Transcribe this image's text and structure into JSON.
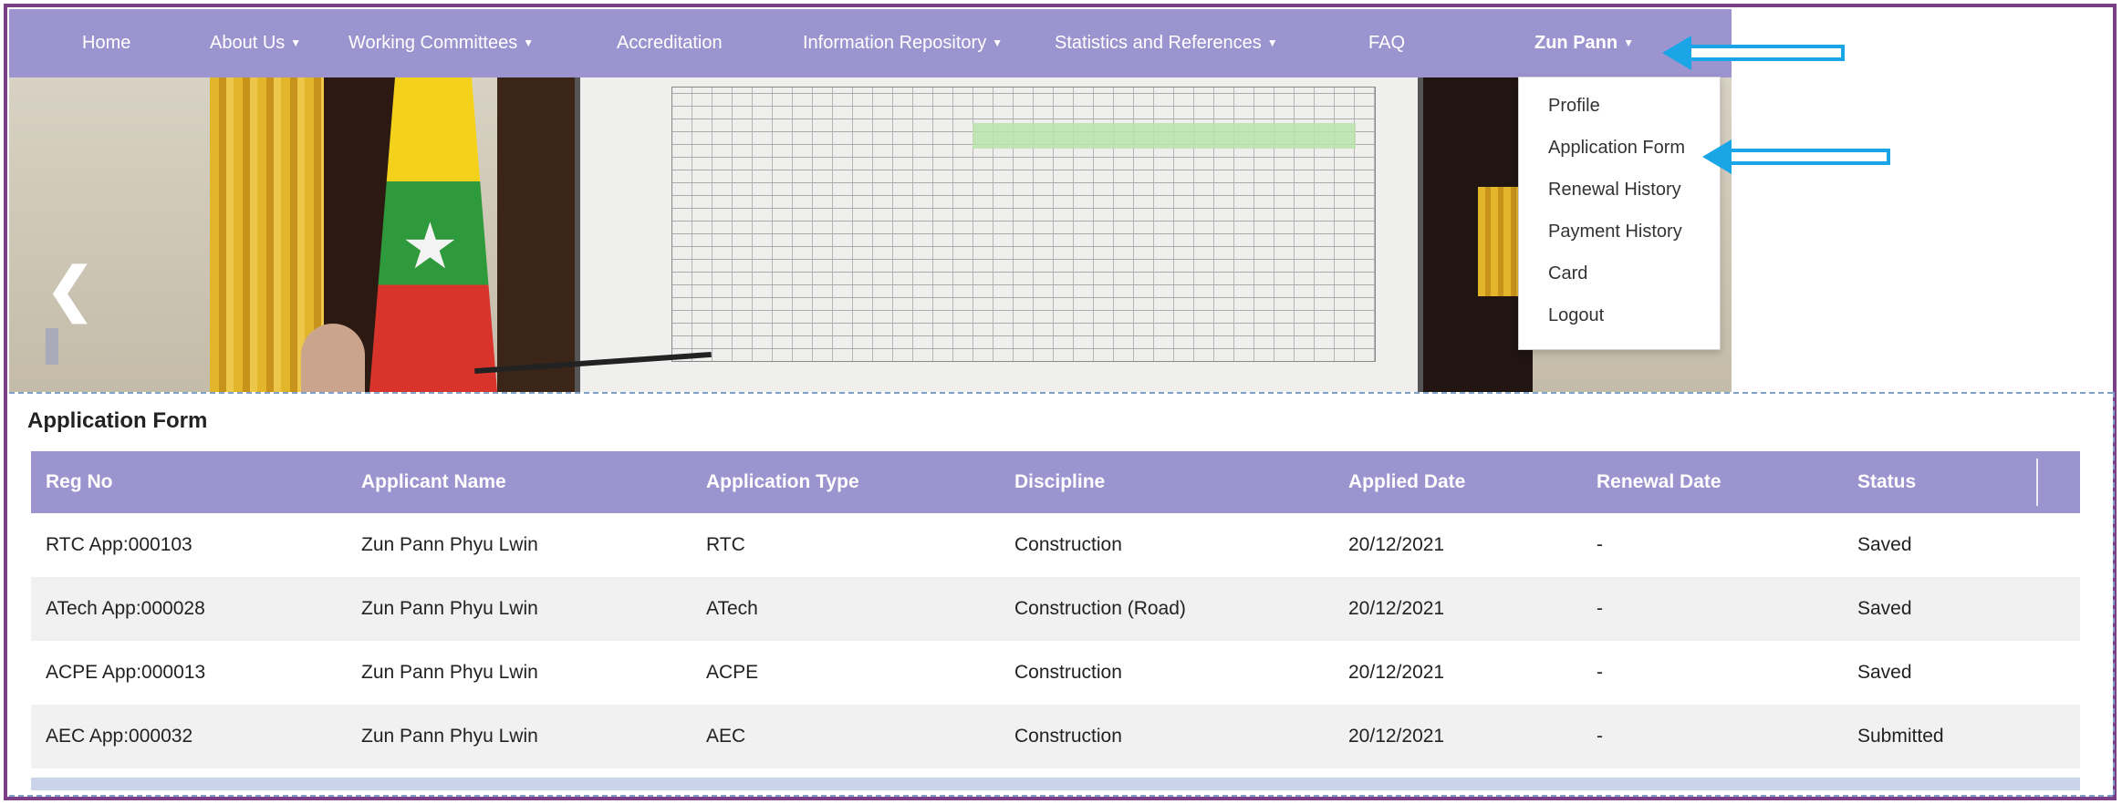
{
  "nav": {
    "home": "Home",
    "about": "About Us",
    "committees": "Working Committees",
    "accreditation": "Accreditation",
    "repository": "Information Repository",
    "statistics": "Statistics and References",
    "faq": "FAQ",
    "user": "Zun Pann"
  },
  "dropdown": {
    "profile": "Profile",
    "application_form": "Application Form",
    "renewal_history": "Renewal History",
    "payment_history": "Payment History",
    "card": "Card",
    "logout": "Logout"
  },
  "banner": {
    "prev_icon": "chevron-left-icon"
  },
  "section": {
    "title": "Application Form"
  },
  "table": {
    "headers": [
      "Reg No",
      "Applicant Name",
      "Application Type",
      "Discipline",
      "Applied Date",
      "Renewal Date",
      "Status"
    ],
    "rows": [
      [
        "RTC App:000103",
        "Zun Pann Phyu Lwin",
        "RTC",
        "Construction",
        "20/12/2021",
        "-",
        "Saved"
      ],
      [
        "ATech App:000028",
        "Zun Pann Phyu Lwin",
        "ATech",
        "Construction (Road)",
        "20/12/2021",
        "-",
        "Saved"
      ],
      [
        "ACPE App:000013",
        "Zun Pann Phyu Lwin",
        "ACPE",
        "Construction",
        "20/12/2021",
        "-",
        "Saved"
      ],
      [
        "AEC App:000032",
        "Zun Pann Phyu Lwin",
        "AEC",
        "Construction",
        "20/12/2021",
        "-",
        "Submitted"
      ]
    ]
  },
  "colors": {
    "nav": "#9b94cf",
    "arrow": "#1aa6e6",
    "frame": "#7a3f85"
  }
}
